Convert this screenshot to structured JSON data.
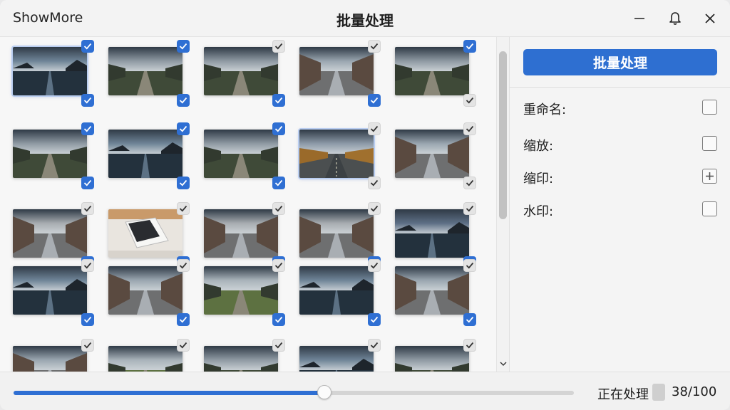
{
  "app": {
    "name": "ShowMore",
    "title": "批量处理"
  },
  "icons": {
    "minimize": "minimize-icon",
    "notify": "bell-icon",
    "close": "close-icon",
    "check": "checkmark-icon",
    "plus": "plus-icon"
  },
  "colors": {
    "accent": "#2f6fd3",
    "unchecked": "#e4e4e4"
  },
  "panel": {
    "batch_button": "批量处理",
    "options": [
      {
        "label": "重命名:",
        "control": "checkbox"
      },
      {
        "label": "缩放:",
        "control": "checkbox"
      },
      {
        "label": "缩印:",
        "control": "plus"
      },
      {
        "label": "水印:",
        "control": "checkbox"
      }
    ]
  },
  "status": {
    "text": "正在处理",
    "count": "38/100",
    "progress": 0.555
  },
  "gallery": {
    "rows": [
      [
        {
          "scene": "lake",
          "top": "on",
          "bottom": "on",
          "highlight": true
        },
        {
          "scene": "field",
          "top": "on",
          "bottom": "on",
          "highlight": false
        },
        {
          "scene": "field",
          "top": "off",
          "bottom": "on",
          "highlight": false
        },
        {
          "scene": "city",
          "top": "off",
          "bottom": "on",
          "highlight": false
        },
        {
          "scene": "field",
          "top": "on",
          "bottom": "off",
          "highlight": false
        }
      ],
      [
        {
          "scene": "field",
          "top": "on",
          "bottom": "on",
          "highlight": false
        },
        {
          "scene": "lake",
          "top": "on",
          "bottom": "on",
          "highlight": false
        },
        {
          "scene": "field",
          "top": "on",
          "bottom": "on",
          "highlight": false
        },
        {
          "scene": "autumn",
          "top": "off",
          "bottom": "off",
          "highlight": true
        },
        {
          "scene": "city",
          "top": "off",
          "bottom": "off",
          "highlight": false
        }
      ],
      [
        {
          "scene": "grey",
          "top": "off",
          "bottom": "on",
          "highlight": false
        },
        {
          "scene": "book",
          "top": "off",
          "bottom": "on",
          "highlight": false
        },
        {
          "scene": "grey",
          "top": "off",
          "bottom": "on",
          "highlight": false
        },
        {
          "scene": "grey",
          "top": "off",
          "bottom": "on",
          "highlight": false
        },
        {
          "scene": "sunset",
          "top": "off",
          "bottom": "on",
          "highlight": false
        }
      ],
      [
        {
          "scene": "lake",
          "top": "off",
          "bottom": "on",
          "highlight": false
        },
        {
          "scene": "city",
          "top": "off",
          "bottom": "on",
          "highlight": false
        },
        {
          "scene": "green",
          "top": "off",
          "bottom": "on",
          "highlight": false
        },
        {
          "scene": "lake",
          "top": "off",
          "bottom": "on",
          "highlight": false
        },
        {
          "scene": "city",
          "top": "off",
          "bottom": "on",
          "highlight": false
        }
      ],
      [
        {
          "scene": "city",
          "top": "off",
          "bottom": "off",
          "highlight": false
        },
        {
          "scene": "green",
          "top": "off",
          "bottom": "off",
          "highlight": false
        },
        {
          "scene": "field",
          "top": "off",
          "bottom": "off",
          "highlight": false
        },
        {
          "scene": "lake",
          "top": "off",
          "bottom": "off",
          "highlight": false
        },
        {
          "scene": "field",
          "top": "off",
          "bottom": "off",
          "highlight": false
        }
      ]
    ]
  }
}
